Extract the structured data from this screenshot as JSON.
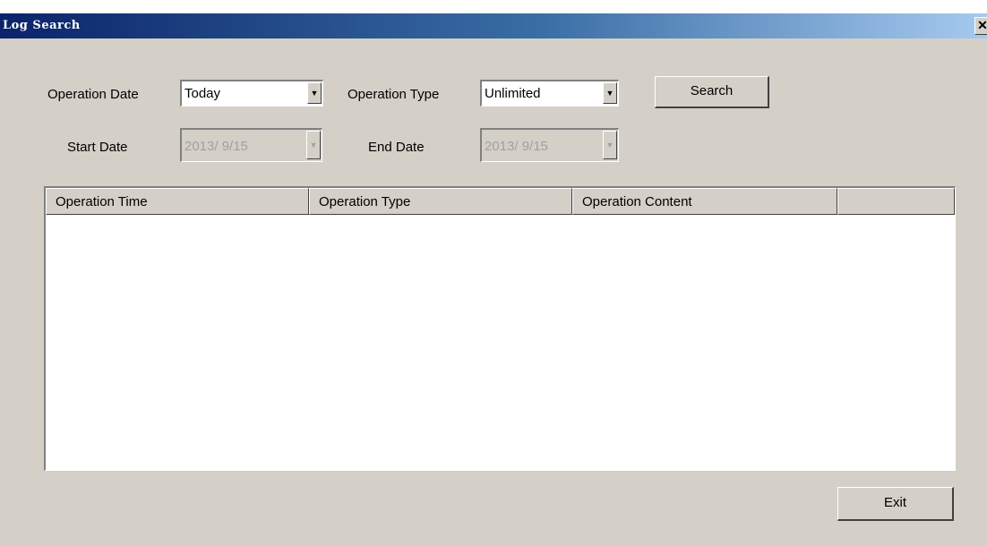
{
  "window": {
    "title": "Log Search",
    "close_glyph": "✕"
  },
  "filters": {
    "operation_date_label": "Operation Date",
    "operation_date_value": "Today",
    "operation_type_label": "Operation Type",
    "operation_type_value": "Unlimited",
    "start_date_label": "Start Date",
    "start_date_value": "2013/  9/15",
    "end_date_label": "End Date",
    "end_date_value": "2013/  9/15",
    "dropdown_icon": "chevron-down-icon"
  },
  "buttons": {
    "search": "Search",
    "exit": "Exit"
  },
  "table": {
    "columns": [
      "Operation Time",
      "Operation Type",
      "Operation Content",
      ""
    ],
    "rows": []
  }
}
